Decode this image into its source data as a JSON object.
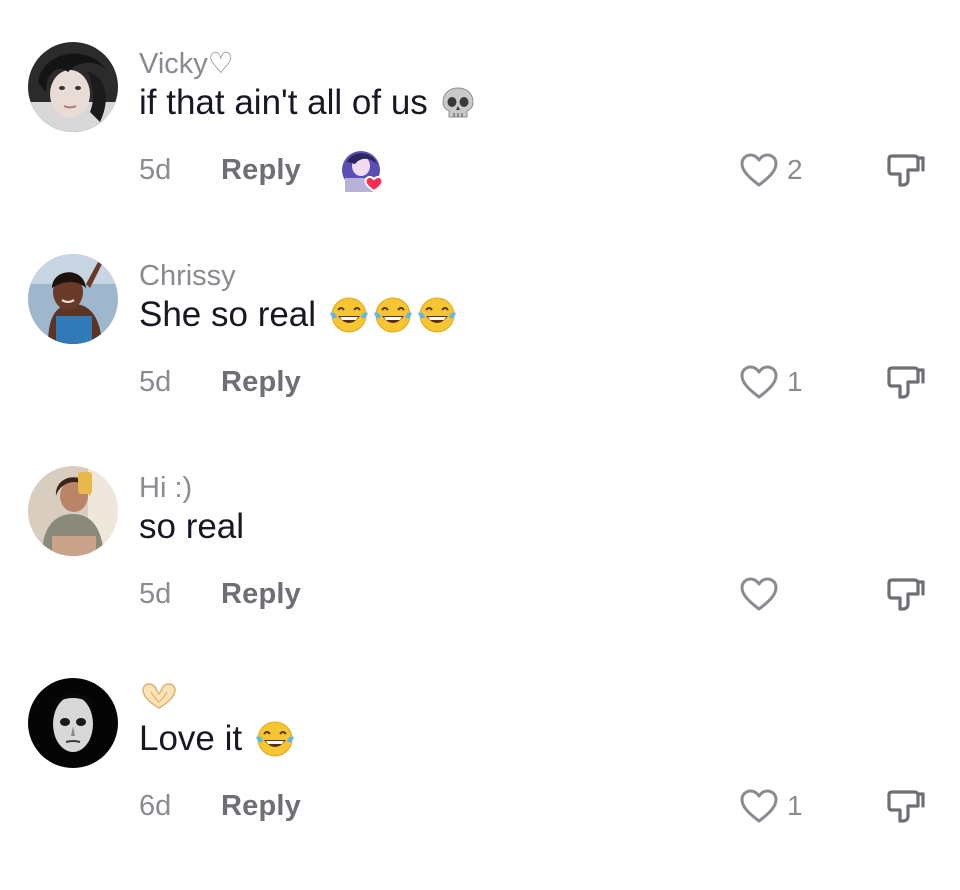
{
  "comments": [
    {
      "username": "Vicky♡",
      "text": "if that ain't all of us",
      "emojis": [
        "skull-emoji"
      ],
      "time": "5d",
      "reply_label": "Reply",
      "creator_liked": true,
      "likes": "2"
    },
    {
      "username": "Chrissy",
      "text": "She so real",
      "emojis": [
        "tears-of-joy-emoji",
        "tears-of-joy-emoji",
        "tears-of-joy-emoji"
      ],
      "time": "5d",
      "reply_label": "Reply",
      "creator_liked": false,
      "likes": "1"
    },
    {
      "username": "Hi :)",
      "text": "so real",
      "emojis": [],
      "time": "5d",
      "reply_label": "Reply",
      "creator_liked": false,
      "likes": ""
    },
    {
      "username": "🫶",
      "text": "Love it",
      "emojis": [
        "tears-of-joy-emoji"
      ],
      "time": "6d",
      "reply_label": "Reply",
      "creator_liked": false,
      "likes": "1"
    }
  ],
  "colors": {
    "text": "#161823",
    "secondary": "#8a8b91",
    "reply": "#6e6f75",
    "heart_badge": "#fe2c55"
  }
}
